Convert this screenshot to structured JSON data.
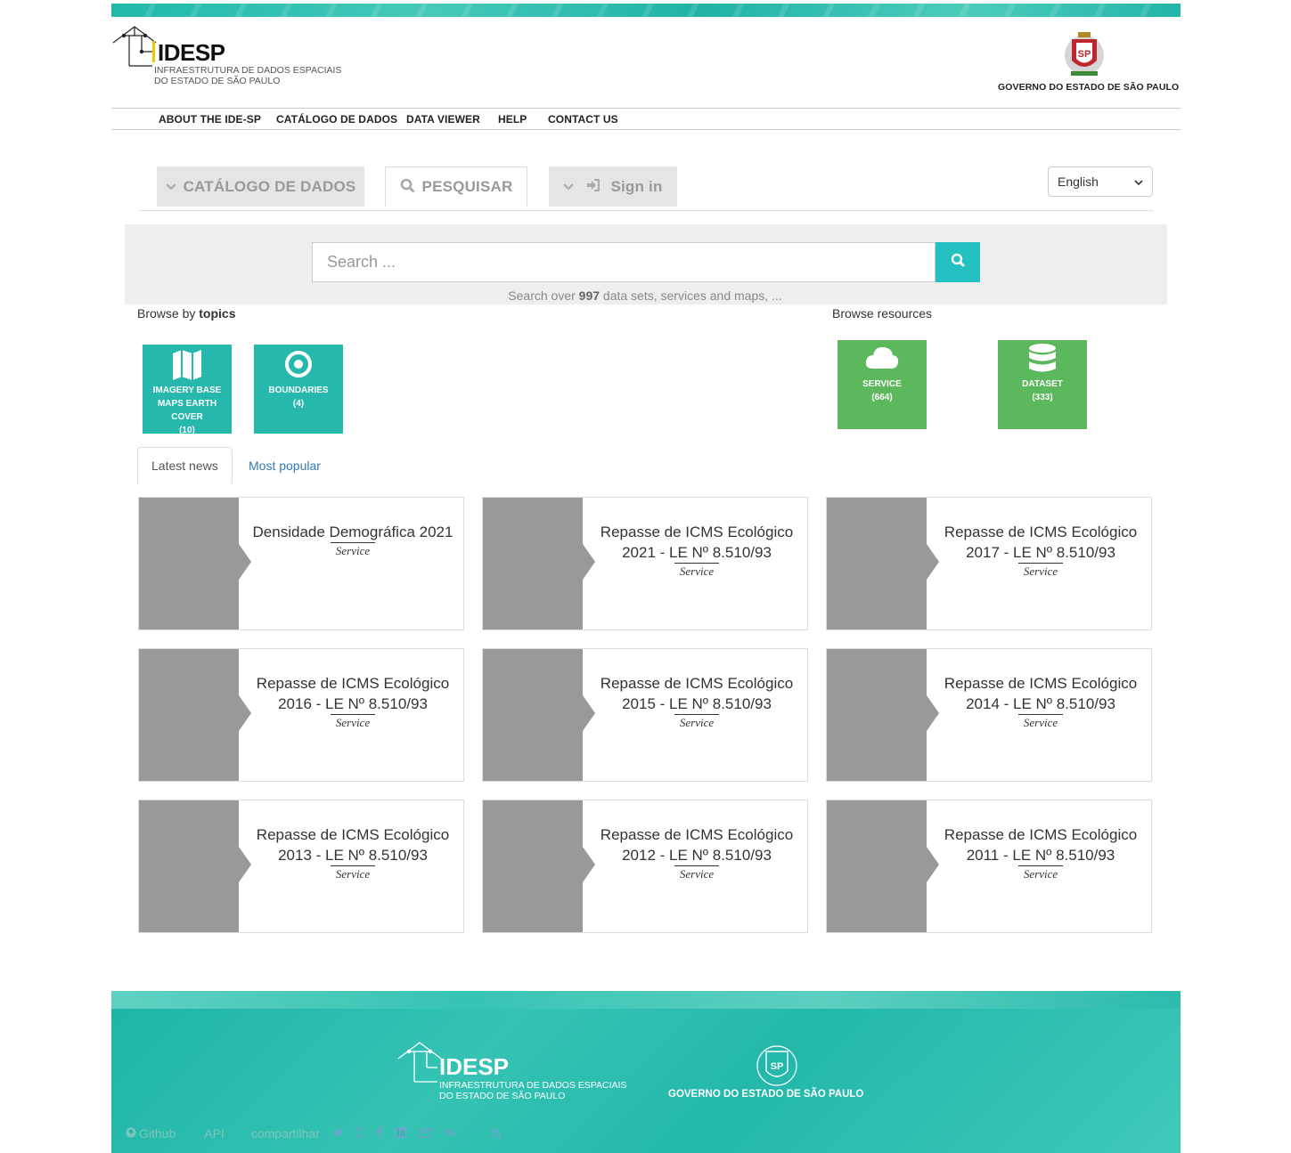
{
  "header": {
    "logo_idesp": {
      "name": "IDESP",
      "line1": "INFRAESTRUTURA DE DADOS ESPACIAIS",
      "line2": "DO ESTADO DE SÃO PAULO"
    },
    "logo_gov": {
      "text": "GOVERNO DO ESTADO DE SÃO PAULO",
      "seal": "SP"
    },
    "nav": [
      "ABOUT THE IDE-SP",
      "CATÁLOGO DE DADOS",
      "DATA VIEWER",
      "HELP",
      "CONTACT US"
    ]
  },
  "gn_bar": {
    "catalog_label": "CATÁLOGO DE DADOS",
    "search_label": "PESQUISAR",
    "signin_label": "Sign in",
    "language": "English"
  },
  "hero": {
    "search_placeholder": "Search ...",
    "caption_prefix": "Search over ",
    "caption_count": "997",
    "caption_suffix": " data sets, services and maps, ..."
  },
  "browse": {
    "topics_prefix": "Browse by ",
    "topics_bold": "topics",
    "resources_label": "Browse resources",
    "topics": [
      {
        "label": "IMAGERY BASE MAPS EARTH COVER",
        "count": "(10)",
        "icon": "map-icon"
      },
      {
        "label": "BOUNDARIES",
        "count": "(4)",
        "icon": "target-icon"
      }
    ],
    "resources": [
      {
        "label": "SERVICE",
        "count": "(664)",
        "icon": "cloud-icon"
      },
      {
        "label": "DATASET",
        "count": "(333)",
        "icon": "database-icon"
      }
    ]
  },
  "tabs": {
    "latest": "Latest news",
    "popular": "Most popular"
  },
  "cards": [
    {
      "title": "Densidade Demográfica 2021",
      "kind": "Service"
    },
    {
      "title": "Repasse de ICMS Ecológico 2021 - LE Nº 8.510/93",
      "kind": "Service"
    },
    {
      "title": "Repasse de ICMS Ecológico 2017 - LE Nº 8.510/93",
      "kind": "Service"
    },
    {
      "title": "Repasse de ICMS Ecológico 2016 - LE Nº 8.510/93",
      "kind": "Service"
    },
    {
      "title": "Repasse de ICMS Ecológico 2015 - LE Nº 8.510/93",
      "kind": "Service"
    },
    {
      "title": "Repasse de ICMS Ecológico 2014 - LE Nº 8.510/93",
      "kind": "Service"
    },
    {
      "title": "Repasse de ICMS Ecológico 2013 - LE Nº 8.510/93",
      "kind": "Service"
    },
    {
      "title": "Repasse de ICMS Ecológico 2012 - LE Nº 8.510/93",
      "kind": "Service"
    },
    {
      "title": "Repasse de ICMS Ecológico 2011 - LE Nº 8.510/93",
      "kind": "Service"
    }
  ],
  "footer": {
    "github": "Github",
    "api": "API",
    "share": "compartilhar",
    "icons": [
      "twitter-icon",
      "google-plus-icon",
      "facebook-icon",
      "linkedin-icon",
      "email-icon",
      "link-icon",
      "rss-icon"
    ]
  },
  "colors": {
    "teal": "#27b8ad",
    "green": "#5cb85c",
    "search_button": "#23c1c1",
    "thumb_grey": "#999999"
  }
}
